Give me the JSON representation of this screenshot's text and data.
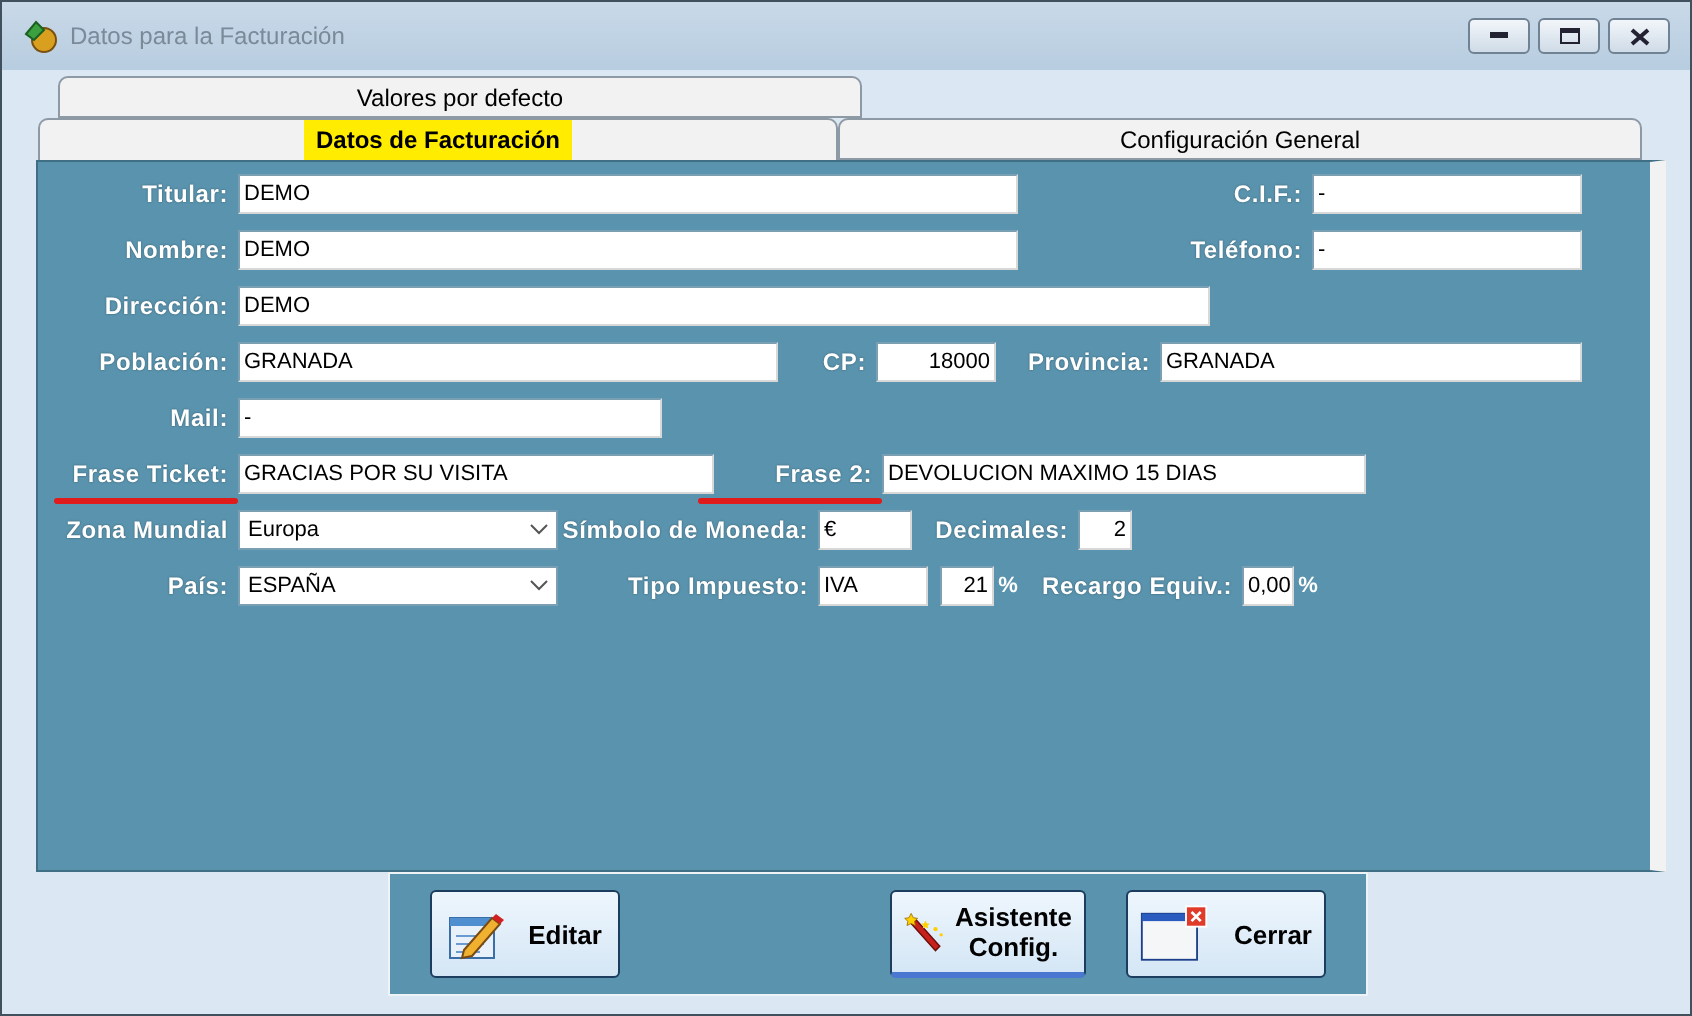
{
  "window": {
    "title": "Datos para la Facturación"
  },
  "tab_rows": [
    [
      {
        "label": "Valores por defecto",
        "selected": false
      }
    ],
    [
      {
        "label": "Datos de Facturación",
        "selected": true
      },
      {
        "label": "Configuración General",
        "selected": false
      }
    ]
  ],
  "form_rows": [
    [
      {
        "label": "Titular:",
        "value": "DEMO",
        "kind": "text"
      },
      {
        "label": "C.I.F.:",
        "value": "-",
        "kind": "text"
      }
    ],
    [
      {
        "label": "Nombre:",
        "value": "DEMO",
        "kind": "text"
      },
      {
        "label": "Teléfono:",
        "value": "-",
        "kind": "text"
      }
    ],
    [
      {
        "label": "Dirección:",
        "value": "DEMO",
        "kind": "text"
      }
    ],
    [
      {
        "label": "Población:",
        "value": "GRANADA",
        "kind": "text"
      },
      {
        "label": "CP:",
        "value": "18000",
        "kind": "number"
      },
      {
        "label": "Provincia:",
        "value": "GRANADA",
        "kind": "text"
      }
    ],
    [
      {
        "label": "Mail:",
        "value": "-",
        "kind": "text"
      }
    ],
    [
      {
        "label": "Frase Ticket:",
        "value": "GRACIAS POR SU VISITA",
        "kind": "text",
        "marked": true
      },
      {
        "label": "Frase 2:",
        "value": "DEVOLUCION MAXIMO 15 DIAS",
        "kind": "text",
        "marked": true
      }
    ],
    [
      {
        "label": "Zona Mundial",
        "value": "Europa",
        "kind": "select"
      },
      {
        "label": "Símbolo de Moneda:",
        "value": "€",
        "kind": "text"
      },
      {
        "label": "Decimales:",
        "value": "2",
        "kind": "number"
      }
    ],
    [
      {
        "label": "País:",
        "value": "ESPAÑA",
        "kind": "select"
      },
      {
        "label": "Tipo Impuesto:",
        "value": "IVA",
        "kind": "text"
      },
      {
        "value": "21",
        "kind": "number",
        "suffix": "%"
      },
      {
        "label": "Recargo Equiv.:",
        "value": "0,00",
        "kind": "text",
        "suffix": "%"
      }
    ]
  ],
  "buttons": [
    {
      "lines": [
        "Editar"
      ],
      "kind": "edit",
      "focused": false
    },
    {
      "lines": [
        "Asistente",
        "Config."
      ],
      "kind": "wand",
      "focused": true
    },
    {
      "lines": [
        "Cerrar"
      ],
      "kind": "window",
      "focused": false
    }
  ]
}
